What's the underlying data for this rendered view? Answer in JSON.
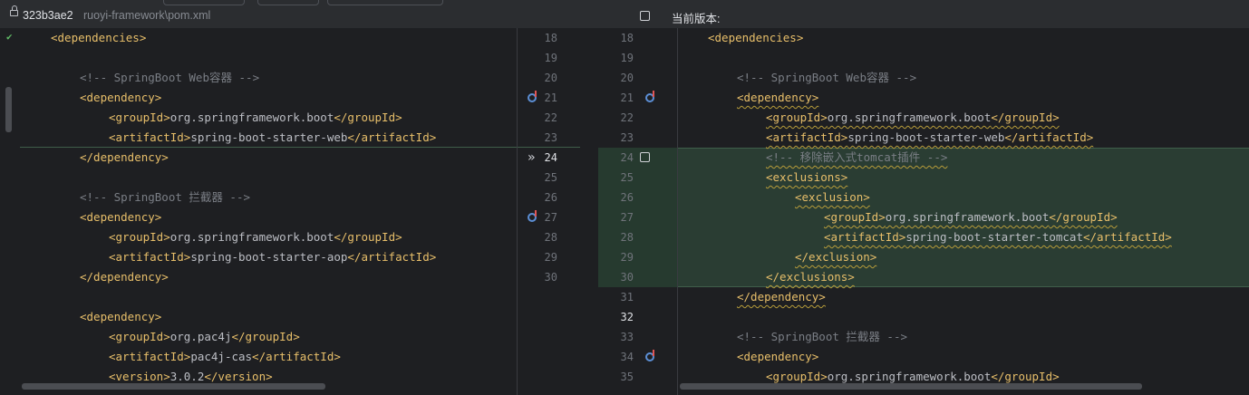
{
  "header": {
    "revision": "323b3ae2",
    "file_path": "ruoyi-framework\\pom.xml",
    "current_version_label": "当前版本:"
  },
  "left_lines": [
    {
      "n": 18,
      "indent": 1,
      "parts": [
        [
          "tag",
          "<dependencies>"
        ]
      ]
    },
    {
      "n": 19,
      "indent": 0,
      "parts": []
    },
    {
      "n": 20,
      "indent": 2,
      "parts": [
        [
          "cmt",
          "<!-- SpringBoot Web容器 -->"
        ]
      ]
    },
    {
      "n": 21,
      "indent": 2,
      "parts": [
        [
          "tag",
          "<dependency>"
        ]
      ]
    },
    {
      "n": 22,
      "indent": 3,
      "parts": [
        [
          "tag",
          "<groupId>"
        ],
        [
          "txt",
          "org.springframework.boot"
        ],
        [
          "tag",
          "</groupId>"
        ]
      ]
    },
    {
      "n": 23,
      "indent": 3,
      "parts": [
        [
          "tag",
          "<artifactId>"
        ],
        [
          "txt",
          "spring-boot-starter-web"
        ],
        [
          "tag",
          "</artifactId>"
        ]
      ]
    },
    {
      "n": 24,
      "indent": 2,
      "parts": [
        [
          "tag",
          "</dependency>"
        ]
      ]
    },
    {
      "n": 25,
      "indent": 0,
      "parts": []
    },
    {
      "n": 26,
      "indent": 2,
      "parts": [
        [
          "cmt",
          "<!-- SpringBoot 拦截器 -->"
        ]
      ]
    },
    {
      "n": 27,
      "indent": 2,
      "parts": [
        [
          "tag",
          "<dependency>"
        ]
      ]
    },
    {
      "n": 28,
      "indent": 3,
      "parts": [
        [
          "tag",
          "<groupId>"
        ],
        [
          "txt",
          "org.springframework.boot"
        ],
        [
          "tag",
          "</groupId>"
        ]
      ]
    },
    {
      "n": 29,
      "indent": 3,
      "parts": [
        [
          "tag",
          "<artifactId>"
        ],
        [
          "txt",
          "spring-boot-starter-aop"
        ],
        [
          "tag",
          "</artifactId>"
        ]
      ]
    },
    {
      "n": 30,
      "indent": 2,
      "parts": [
        [
          "tag",
          "</dependency>"
        ]
      ]
    },
    {
      "n": 31,
      "indent": 0,
      "parts": []
    },
    {
      "n": 32,
      "indent": 2,
      "parts": [
        [
          "tag",
          "<dependency>"
        ]
      ]
    },
    {
      "n": 33,
      "indent": 3,
      "parts": [
        [
          "tag",
          "<groupId>"
        ],
        [
          "txt",
          "org.pac4j"
        ],
        [
          "tag",
          "</groupId>"
        ]
      ]
    },
    {
      "n": 34,
      "indent": 3,
      "parts": [
        [
          "tag",
          "<artifactId>"
        ],
        [
          "txt",
          "pac4j-cas"
        ],
        [
          "tag",
          "</artifactId>"
        ]
      ]
    },
    {
      "n": 35,
      "indent": 3,
      "parts": [
        [
          "tag",
          "<version>"
        ],
        [
          "txt",
          "3.0.2"
        ],
        [
          "tag",
          "</version>"
        ]
      ]
    }
  ],
  "left_gutter_numbers": [
    "18",
    "19",
    "20",
    "21",
    "22",
    "23",
    "24",
    "25",
    "26",
    "27",
    "28",
    "29",
    "30"
  ],
  "right_gutter_numbers": [
    "18",
    "19",
    "20",
    "21",
    "22",
    "23",
    "24",
    "25",
    "26",
    "27",
    "28",
    "29",
    "30",
    "31",
    "32",
    "33",
    "34",
    "35"
  ],
  "right_lines": [
    {
      "indent": 1,
      "wavy": false,
      "parts": [
        [
          "tag",
          "<dependencies>"
        ]
      ]
    },
    {
      "indent": 0,
      "wavy": false,
      "parts": []
    },
    {
      "indent": 2,
      "wavy": false,
      "parts": [
        [
          "cmt",
          "<!-- SpringBoot Web容器 -->"
        ]
      ]
    },
    {
      "indent": 2,
      "wavy": true,
      "parts": [
        [
          "tag",
          "<dependency>"
        ]
      ]
    },
    {
      "indent": 3,
      "wavy": true,
      "parts": [
        [
          "tag",
          "<groupId>"
        ],
        [
          "txt",
          "org.springframework.boot"
        ],
        [
          "tag",
          "</groupId>"
        ]
      ]
    },
    {
      "indent": 3,
      "wavy": true,
      "parts": [
        [
          "tag",
          "<artifactId>"
        ],
        [
          "txt",
          "spring-boot-starter-web"
        ],
        [
          "tag",
          "</artifactId>"
        ]
      ]
    },
    {
      "indent": 3,
      "wavy": true,
      "parts": [
        [
          "cmt",
          "<!-- 移除嵌入式tomcat插件 -->"
        ]
      ]
    },
    {
      "indent": 3,
      "wavy": true,
      "parts": [
        [
          "tag",
          "<exclusions>"
        ]
      ]
    },
    {
      "indent": 4,
      "wavy": true,
      "parts": [
        [
          "tag",
          "<exclusion>"
        ]
      ]
    },
    {
      "indent": 5,
      "wavy": true,
      "parts": [
        [
          "tag",
          "<groupId>"
        ],
        [
          "txt",
          "org.springframework.boot"
        ],
        [
          "tag",
          "</groupId>"
        ]
      ]
    },
    {
      "indent": 5,
      "wavy": true,
      "parts": [
        [
          "tag",
          "<artifactId>"
        ],
        [
          "txt",
          "spring-boot-starter-tomcat"
        ],
        [
          "tag",
          "</artifactId>"
        ]
      ]
    },
    {
      "indent": 4,
      "wavy": true,
      "parts": [
        [
          "tag",
          "</exclusion>"
        ]
      ]
    },
    {
      "indent": 3,
      "wavy": true,
      "parts": [
        [
          "tag",
          "</exclusions>"
        ]
      ]
    },
    {
      "indent": 2,
      "wavy": true,
      "parts": [
        [
          "tag",
          "</dependency>"
        ]
      ]
    },
    {
      "indent": 0,
      "wavy": false,
      "parts": []
    },
    {
      "indent": 2,
      "wavy": false,
      "parts": [
        [
          "cmt",
          "<!-- SpringBoot 拦截器 -->"
        ]
      ]
    },
    {
      "indent": 2,
      "wavy": false,
      "parts": [
        [
          "tag",
          "<dependency>"
        ]
      ]
    },
    {
      "indent": 3,
      "wavy": false,
      "parts": [
        [
          "tag",
          "<groupId>"
        ],
        [
          "txt",
          "org.springframework.boot"
        ],
        [
          "tag",
          "</groupId>"
        ]
      ]
    }
  ],
  "highlight_line_numbers": [
    "24",
    "32"
  ],
  "colors": {
    "tag": "#e8bf6a",
    "text": "#bcbec4",
    "comment": "#7a7e85",
    "changed_background": "#2a3d33"
  },
  "icons": [
    "lock-icon",
    "checkbox-icon",
    "check-icon",
    "merge-arrow-icon",
    "gutter-override-icon"
  ]
}
